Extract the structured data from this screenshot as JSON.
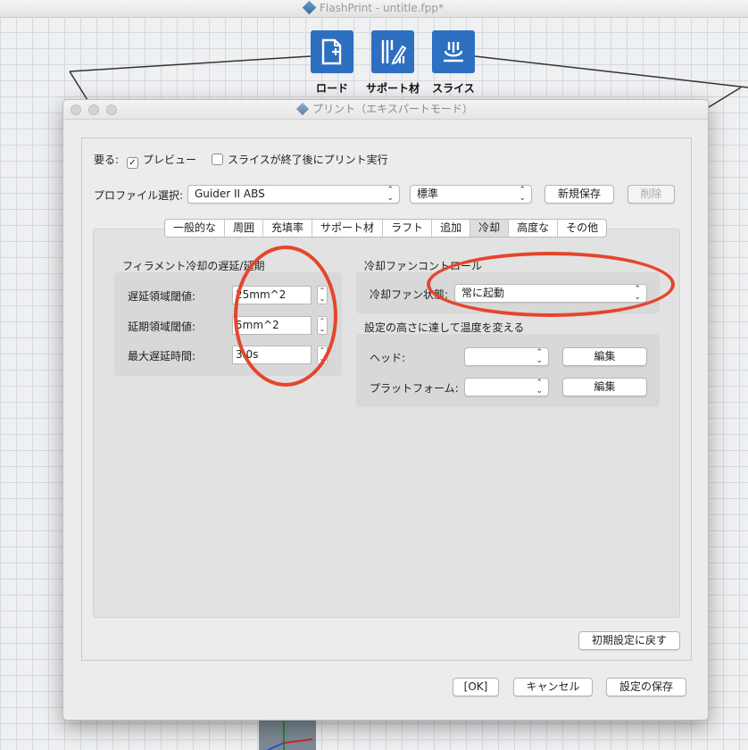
{
  "app": {
    "title": "FlashPrint - untitle.fpp*"
  },
  "toolbar": {
    "load_label": "ロード",
    "support_label": "サポート材",
    "slice_label": "スライス"
  },
  "dialog": {
    "title": "プリント（エキスパートモード）",
    "require_label": "要る:",
    "preview_label": "プレビュー",
    "preview_checked": true,
    "print_after_slice_label": "スライスが終了後にプリント実行",
    "print_after_slice_checked": false,
    "profile_label": "プロファイル選択:",
    "profile_value": "Guider II ABS",
    "quality_value": "標準",
    "save_new_label": "新規保存",
    "delete_label": "削除",
    "tabs": [
      "一般的な",
      "周囲",
      "充填率",
      "サポート材",
      "ラフト",
      "追加",
      "冷却",
      "高度な",
      "その他"
    ],
    "active_tab": "冷却",
    "delay_group": {
      "title": "フィラメント冷却の遅延/延期",
      "slowdown_threshold_label": "遅延領域閾値:",
      "slowdown_threshold_value": "25mm^2",
      "extend_threshold_label": "延期領域閾値:",
      "extend_threshold_value": "5mm^2",
      "max_delay_label": "最大遅延時間:",
      "max_delay_value": "3.0s"
    },
    "fan_group": {
      "title": "冷却ファンコントロール",
      "fan_state_label": "冷却ファン状態:",
      "fan_state_value": "常に起動"
    },
    "temp_group": {
      "title": "設定の高さに達して温度を変える",
      "head_label": "ヘッド:",
      "head_value": "",
      "platform_label": "プラットフォーム:",
      "platform_value": "",
      "edit_label": "編集"
    },
    "reset_label": "初期設定に戻す",
    "ok_label": "[OK]",
    "cancel_label": "キャンセル",
    "save_settings_label": "設定の保存"
  },
  "colors": {
    "toolbar_button": "#2d6fc0",
    "annotation_circle": "#e4462c"
  }
}
